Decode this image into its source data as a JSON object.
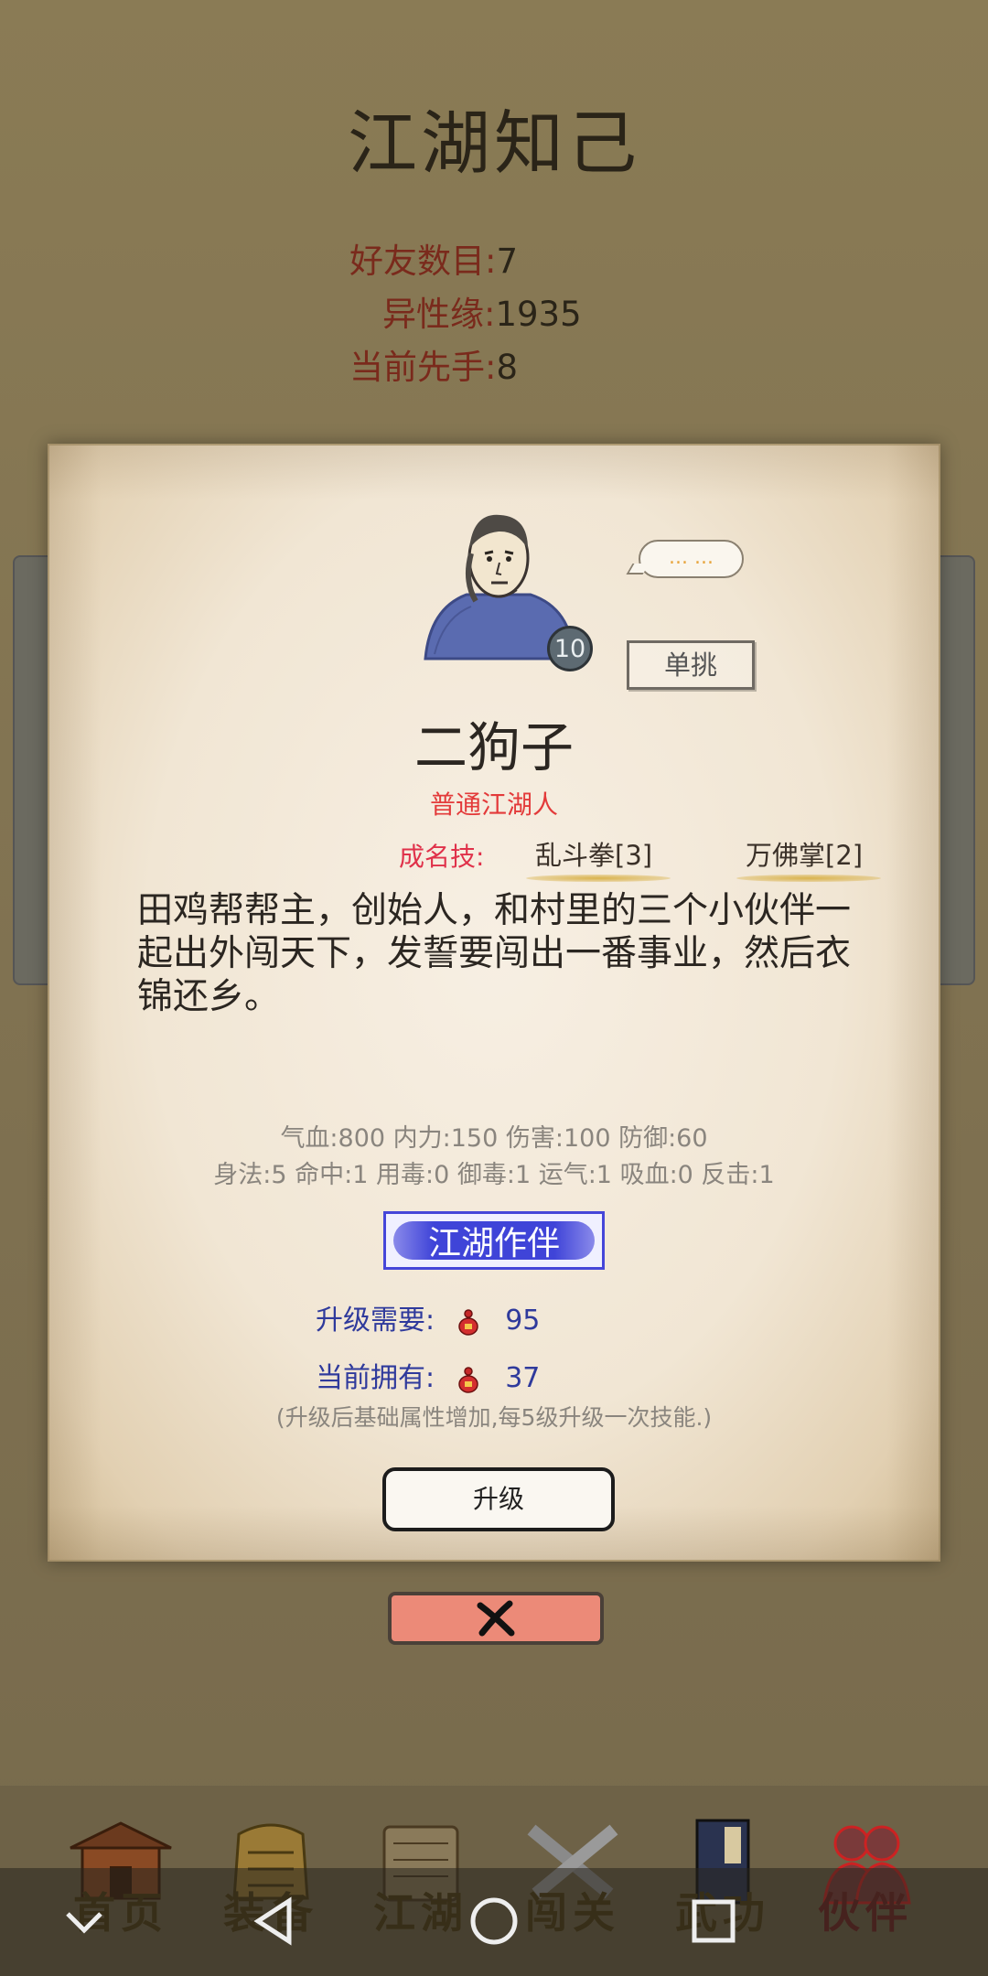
{
  "page": {
    "title": "江湖知己",
    "stats": [
      {
        "label": "好友数目:",
        "value": "7"
      },
      {
        "label": "异性缘:",
        "value": "1935"
      },
      {
        "label": "当前先手:",
        "value": "8"
      }
    ]
  },
  "modal": {
    "level": "10",
    "speech": "... ...",
    "duel_label": "单挑",
    "name": "二狗子",
    "title": "普通江湖人",
    "skills_label": "成名技:",
    "skills": [
      "乱斗拳[3]",
      "万佛掌[2]"
    ],
    "description": "田鸡帮帮主，创始人，和村里的三个小伙伴一起出外闯天下，发誓要闯出一番事业，然后衣锦还乡。",
    "attrs_line1": "气血:800  内力:150  伤害:100  防御:60",
    "attrs_line2": "身法:5  命中:1  用毒:0  御毒:1  运气:1  吸血:0  反击:1",
    "companion_label": "江湖作伴",
    "cost_required_label": "升级需要:",
    "cost_required_value": "95",
    "cost_owned_label": "当前拥有:",
    "cost_owned_value": "37",
    "note": "(升级后基础属性增加,每5级升级一次技能.)",
    "upgrade_label": "升级"
  },
  "tabs": [
    {
      "label": "首页",
      "icon": "house-icon"
    },
    {
      "label": "装备",
      "icon": "armor-icon"
    },
    {
      "label": "江湖",
      "icon": "scroll-icon"
    },
    {
      "label": "闯关",
      "icon": "swords-icon"
    },
    {
      "label": "武功",
      "icon": "book-icon"
    },
    {
      "label": "伙伴",
      "icon": "partners-icon"
    }
  ],
  "colors": {
    "accent_red": "#e33a3a",
    "companion_blue": "#3f44d8",
    "close_salmon": "#ec8a78"
  }
}
